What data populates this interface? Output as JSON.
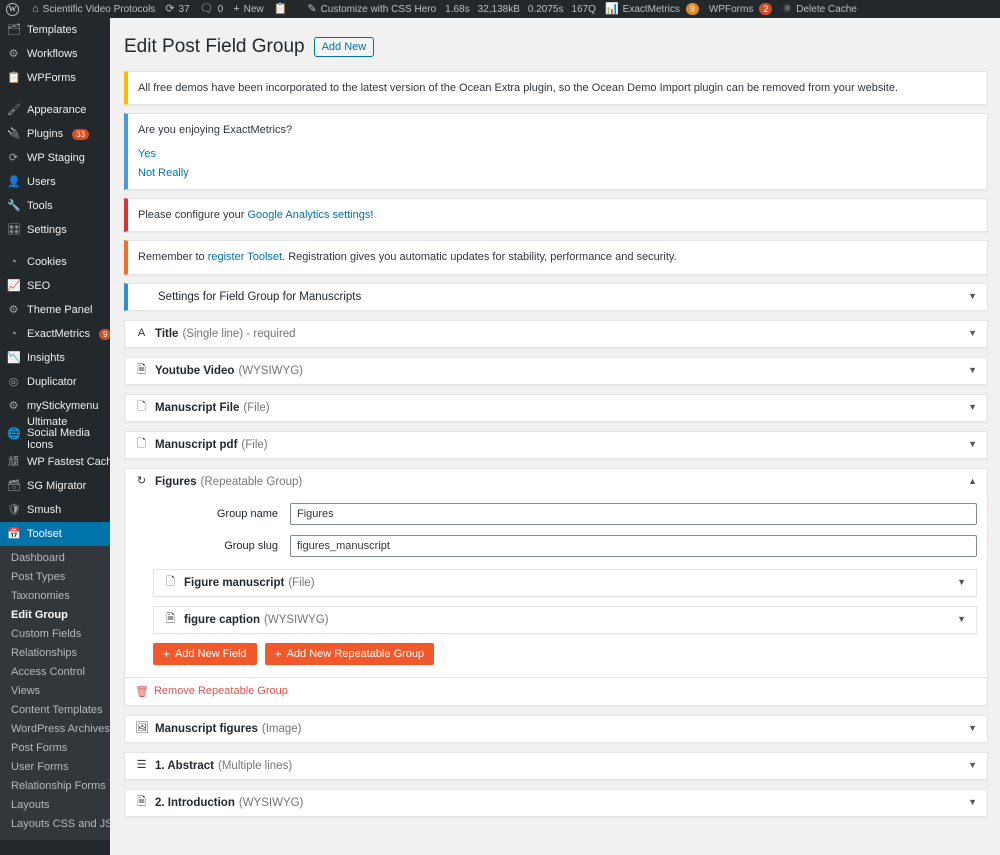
{
  "adminbar": {
    "logo_icon": "wordpress-logo-icon",
    "site": {
      "icon": "home-icon",
      "label": "Scientific Video Protocols"
    },
    "updates": {
      "icon": "updates-icon",
      "count": "37"
    },
    "comments": {
      "icon": "comment-bubble-icon",
      "count": "0"
    },
    "new": {
      "icon": "plus-icon",
      "label": "New"
    },
    "wpforms_bar": {
      "icon": "wpforms-icon",
      "label": ""
    },
    "css_hero": {
      "icon": "pencil-icon",
      "label": "Customize with CSS Hero"
    },
    "perf": {
      "load_time": "1.68s",
      "memory": "32,138kB",
      "db_time": "0.2075s",
      "queries": "167Q"
    },
    "exactmetrics": {
      "icon": "bar-chart-icon",
      "label": "ExactMetrics",
      "count": "9"
    },
    "wpforms": {
      "icon": "",
      "label": "WPForms",
      "count": "2"
    },
    "delete_cache": {
      "icon": "fastest-cache-icon",
      "label": "Delete Cache"
    }
  },
  "sidebar": {
    "items": [
      {
        "icon": "templates-icon",
        "label": "Templates",
        "badge": null,
        "current": false,
        "sep_after": false
      },
      {
        "icon": "workflows-gear-icon",
        "label": "Workflows",
        "badge": null,
        "current": false,
        "sep_after": false
      },
      {
        "icon": "wpforms-icon",
        "label": "WPForms",
        "badge": null,
        "current": false,
        "sep_after": true
      },
      {
        "icon": "appearance-brush-icon",
        "label": "Appearance",
        "badge": null,
        "current": false,
        "sep_after": false
      },
      {
        "icon": "plugins-plug-icon",
        "label": "Plugins",
        "badge": "33",
        "current": false,
        "sep_after": false
      },
      {
        "icon": "wp-staging-refresh-icon",
        "label": "WP Staging",
        "badge": null,
        "current": false,
        "sep_after": false
      },
      {
        "icon": "users-icon",
        "label": "Users",
        "badge": null,
        "current": false,
        "sep_after": false
      },
      {
        "icon": "tools-wrench-icon",
        "label": "Tools",
        "badge": null,
        "current": false,
        "sep_after": false
      },
      {
        "icon": "settings-sliders-icon",
        "label": "Settings",
        "badge": null,
        "current": false,
        "sep_after": true
      },
      {
        "icon": "cookies-icon",
        "label": "Cookies",
        "badge": null,
        "current": false,
        "sep_after": false
      },
      {
        "icon": "seo-icon",
        "label": "SEO",
        "badge": null,
        "current": false,
        "sep_after": false
      },
      {
        "icon": "theme-panel-gear-icon",
        "label": "Theme Panel",
        "badge": null,
        "current": false,
        "sep_after": false
      },
      {
        "icon": "exactmetrics-icon",
        "label": "ExactMetrics",
        "badge": "9",
        "current": false,
        "sep_after": false
      },
      {
        "icon": "insights-icon",
        "label": "Insights",
        "badge": null,
        "current": false,
        "sep_after": false
      },
      {
        "icon": "duplicator-icon",
        "label": "Duplicator",
        "badge": null,
        "current": false,
        "sep_after": false
      },
      {
        "icon": "mystickymenu-gear-icon",
        "label": "myStickymenu",
        "badge": null,
        "current": false,
        "sep_after": false
      },
      {
        "icon": "ultimate-social-media-icons-icon",
        "label": "Ultimate Social Media Icons",
        "badge": null,
        "current": false,
        "two_line": true,
        "sep_after": false
      },
      {
        "icon": "wp-fastest-cache-icon",
        "label": "WP Fastest Cache",
        "badge": null,
        "current": false,
        "sep_after": false
      },
      {
        "icon": "sg-migrator-icon",
        "label": "SG Migrator",
        "badge": null,
        "current": false,
        "sep_after": false
      },
      {
        "icon": "smush-icon",
        "label": "Smush",
        "badge": null,
        "current": false,
        "sep_after": false
      },
      {
        "icon": "toolset-icon",
        "label": "Toolset",
        "badge": null,
        "current": true,
        "sep_after": false
      }
    ],
    "submenu": [
      {
        "label": "Dashboard",
        "current": false
      },
      {
        "label": "Post Types",
        "current": false
      },
      {
        "label": "Taxonomies",
        "current": false
      },
      {
        "label": "Edit Group",
        "current": true
      },
      {
        "label": "Custom Fields",
        "current": false
      },
      {
        "label": "Relationships",
        "current": false
      },
      {
        "label": "Access Control",
        "current": false
      },
      {
        "label": "Views",
        "current": false
      },
      {
        "label": "Content Templates",
        "current": false
      },
      {
        "label": "WordPress Archives",
        "current": false
      },
      {
        "label": "Post Forms",
        "current": false
      },
      {
        "label": "User Forms",
        "current": false
      },
      {
        "label": "Relationship Forms",
        "current": false
      },
      {
        "label": "Layouts",
        "current": false
      },
      {
        "label": "Layouts CSS and JS",
        "current": false
      }
    ]
  },
  "page": {
    "title": "Edit Post Field Group",
    "add_new_label": "Add New"
  },
  "notices": [
    {
      "kind": "warn",
      "text": "All free demos have been incorporated to the latest version of the Ocean Extra plugin, so the Ocean Demo Import plugin can be removed from your website."
    },
    {
      "kind": "info",
      "text": "Are you enjoying ExactMetrics?",
      "links": [
        "Yes",
        "Not Really"
      ]
    },
    {
      "kind": "error",
      "text_before": "Please configure your ",
      "link": "Google Analytics settings",
      "text_after": "!"
    },
    {
      "kind": "alt",
      "text_before": "Remember to ",
      "link": "register Toolset",
      "text_after": ". Registration gives you automatic updates for stability, performance and security."
    }
  ],
  "fields": {
    "settings_panel": {
      "icon": "settings-panel-icon",
      "name": "Settings for Field Group for Manuscripts",
      "type": "",
      "toggle": "chevron-down-icon"
    },
    "rows": [
      {
        "icon": "single-line-A-icon",
        "name": "Title",
        "type": "(Single line) - required",
        "toggle": "chevron-down-icon"
      },
      {
        "icon": "wysiwyg-icon",
        "name": "Youtube Video",
        "type": "(WYSIWYG)",
        "toggle": "chevron-down-icon"
      },
      {
        "icon": "file-icon",
        "name": "Manuscript File",
        "type": "(File)",
        "toggle": "chevron-down-icon"
      },
      {
        "icon": "file-icon",
        "name": "Manuscript pdf",
        "type": "(File)",
        "toggle": "chevron-down-icon"
      }
    ],
    "repeatable_group": {
      "icon": "repeatable-group-icon",
      "name": "Figures",
      "type": "(Repeatable Group)",
      "toggle": "chevron-up-icon",
      "group_name_label": "Group name",
      "group_name_value": "Figures",
      "group_slug_label": "Group slug",
      "group_slug_value": "figures_manuscript",
      "nested_rows": [
        {
          "icon": "file-icon",
          "name": "Figure manuscript",
          "type": "(File)",
          "toggle": "chevron-down-icon"
        },
        {
          "icon": "wysiwyg-icon",
          "name": "figure caption",
          "type": "(WYSIWYG)",
          "toggle": "chevron-down-icon"
        }
      ],
      "add_field_label": "Add New Field",
      "add_group_label": "Add New Repeatable Group",
      "remove_label": "Remove Repeatable Group",
      "remove_icon": "trash-icon"
    },
    "rows_after": [
      {
        "icon": "image-icon",
        "name": "Manuscript figures",
        "type": "(Image)",
        "toggle": "chevron-down-icon"
      },
      {
        "icon": "multiple-lines-icon",
        "name": "1. Abstract",
        "type": "(Multiple lines)",
        "toggle": "chevron-down-icon"
      },
      {
        "icon": "wysiwyg-icon",
        "name": "2. Introduction",
        "type": "(WYSIWYG)",
        "toggle": "chevron-down-icon"
      }
    ]
  },
  "colors": {
    "admin_dark": "#23282d",
    "accent_blue": "#0073aa",
    "orange_button": "#f1592a",
    "notice_warn": "#ffb900",
    "notice_info": "#4a9bd4",
    "notice_error": "#dc3232",
    "notice_alt": "#f56e28"
  }
}
